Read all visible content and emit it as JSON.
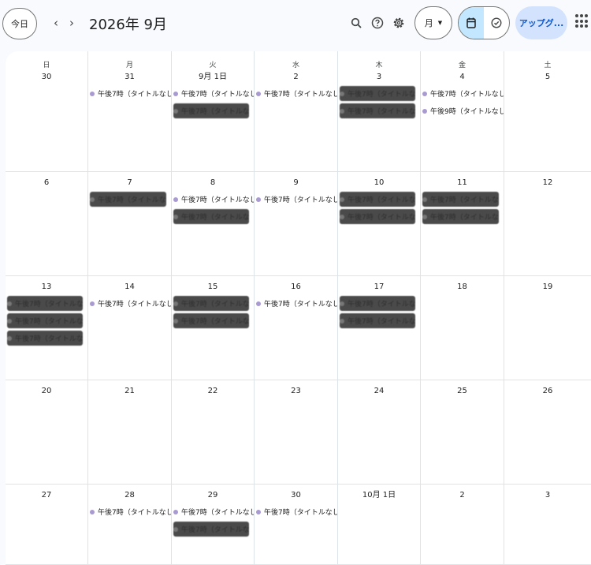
{
  "header": {
    "today_label": "今日",
    "title": "2026年 9月",
    "view_label": "月",
    "upgrade_label": "アップグ..."
  },
  "weekdays": [
    "日",
    "月",
    "火",
    "水",
    "木",
    "金",
    "土"
  ],
  "event_label": "午後7時（タイトルなし",
  "weeks": [
    [
      "30",
      "31",
      "9月 1日",
      "2",
      "3",
      "4",
      "5"
    ],
    [
      "6",
      "7",
      "8",
      "9",
      "10",
      "11",
      "12"
    ],
    [
      "13",
      "14",
      "15",
      "16",
      "17",
      "18",
      "19"
    ],
    [
      "20",
      "21",
      "22",
      "23",
      "24",
      "25",
      "26"
    ],
    [
      "27",
      "28",
      "29",
      "30",
      "10月 1日",
      "2",
      "3"
    ]
  ],
  "events": {
    "w0d1": [
      "午後7時（タイトルなし"
    ],
    "w0d2": [
      "午後7時（タイトルなし"
    ],
    "w0d3": [
      "午後7時（タイトルなし"
    ],
    "w0d5": [
      "午後7時（タイトルなし",
      "午後9時（タイトルなし"
    ],
    "w1d2": [
      "午後7時（タイトルなし"
    ],
    "w1d3": [
      "午後7時（タイトルなし"
    ],
    "w2d1": [
      "午後7時（タイトルなし"
    ],
    "w2d3": [
      "午後7時（タイトルなし"
    ],
    "w4d1": [
      "午後7時（タイトルなし"
    ],
    "w4d2": [
      "午後7時（タイトルなし"
    ],
    "w4d3": [
      "午後7時（タイトルなし"
    ]
  },
  "redacted": {
    "w0d2": 1,
    "w0d4": 2,
    "w1d1": 1,
    "w1d2": 1,
    "w1d4": 2,
    "w1d5": 2,
    "w2d0": 3,
    "w2d2": 2,
    "w2d4": 2,
    "w4d2": 1
  },
  "colors": {
    "event_dot": "#a99bd1",
    "accent": "#c2e7ff",
    "upgrade_bg": "#d3e3fd"
  }
}
